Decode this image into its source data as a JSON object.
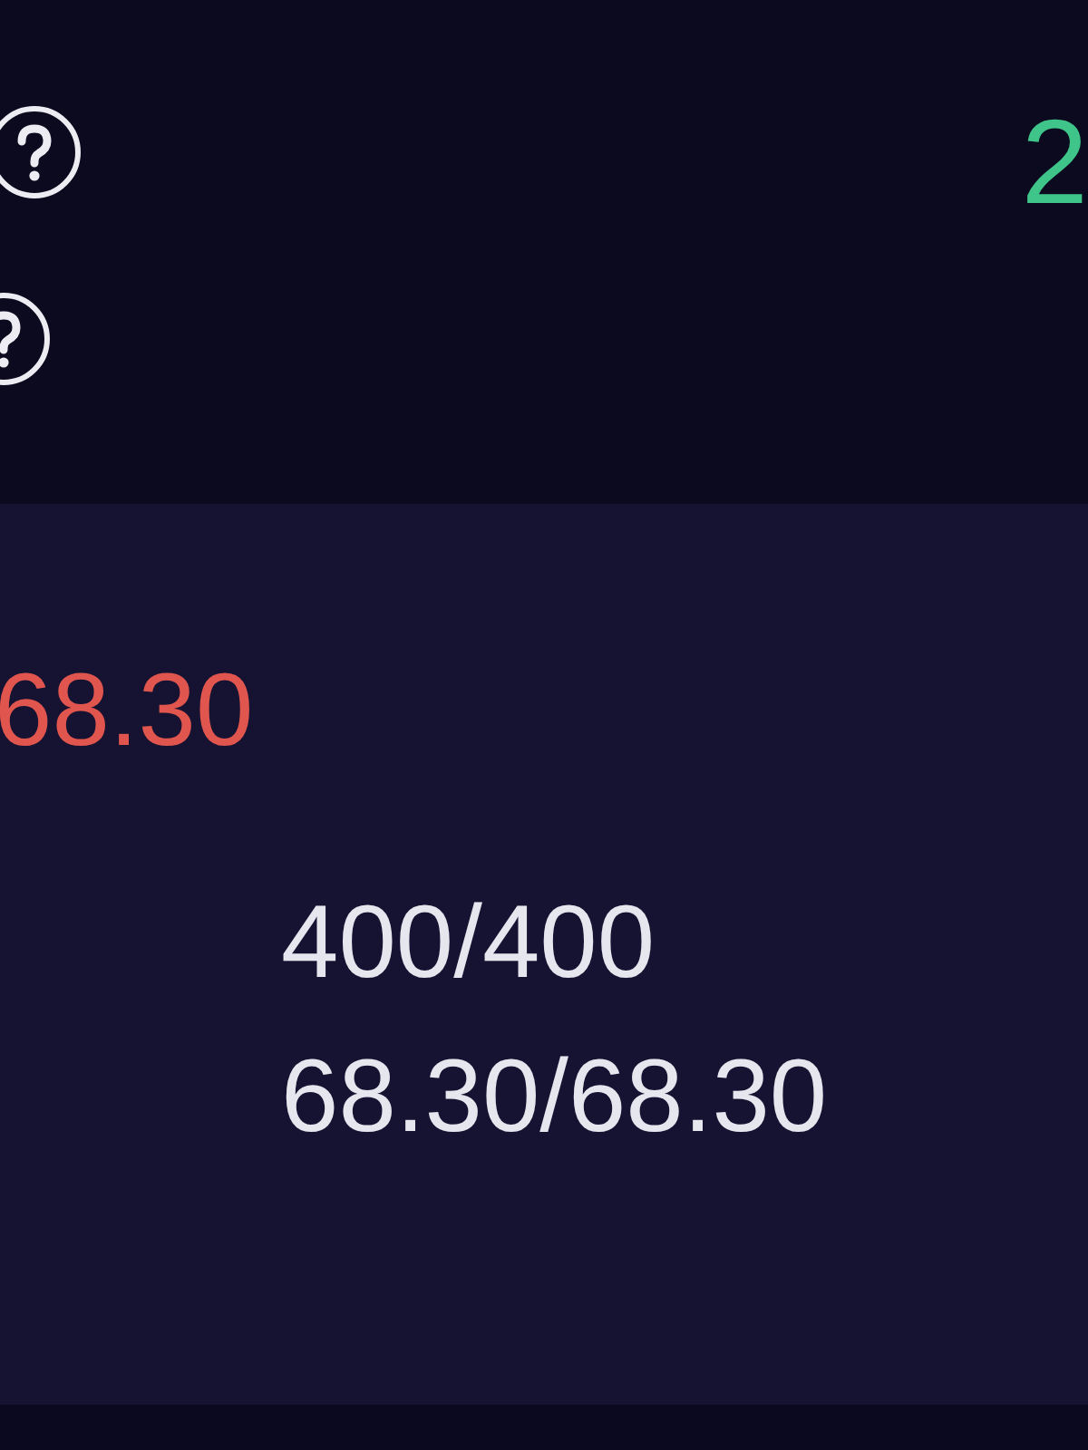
{
  "header": {
    "value": "2"
  },
  "panel": {
    "price": "68.30",
    "rows": [
      "400/400",
      "68.30/68.30"
    ]
  }
}
